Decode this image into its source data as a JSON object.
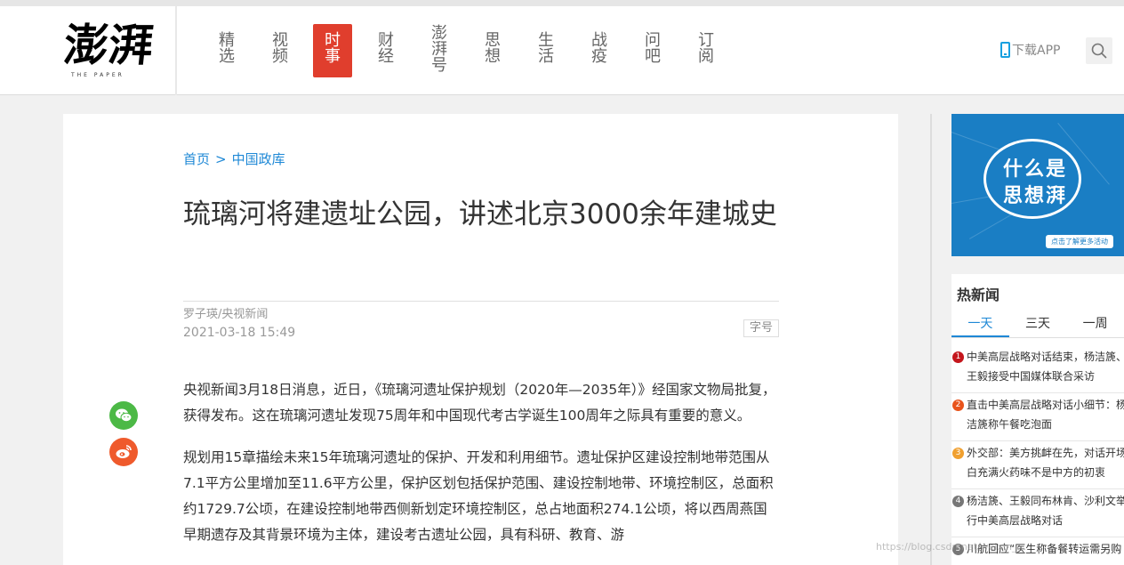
{
  "header": {
    "logo_cn": "澎湃",
    "logo_en": "THE PAPER",
    "nav": [
      {
        "line1": "精",
        "line2": "选",
        "line3": ""
      },
      {
        "line1": "视",
        "line2": "频",
        "line3": ""
      },
      {
        "line1": "时",
        "line2": "事",
        "line3": ""
      },
      {
        "line1": "财",
        "line2": "经",
        "line3": ""
      },
      {
        "line1": "澎",
        "line2": "湃",
        "line3": "号"
      },
      {
        "line1": "思",
        "line2": "想",
        "line3": ""
      },
      {
        "line1": "生",
        "line2": "活",
        "line3": ""
      },
      {
        "line1": "战",
        "line2": "疫",
        "line3": ""
      },
      {
        "line1": "问",
        "line2": "吧",
        "line3": ""
      },
      {
        "line1": "订",
        "line2": "阅",
        "line3": ""
      }
    ],
    "active_nav": "时事",
    "download": "下载APP"
  },
  "article": {
    "breadcrumb_home": "首页",
    "breadcrumb_sep": ">",
    "breadcrumb_section": "中国政库",
    "title": "琉璃河将建遗址公园，讲述北京3000余年建城史",
    "author": "罗子瑛/央视新闻",
    "date": "2021-03-18 15:49",
    "font_size_label": "字号",
    "paragraph1": "央视新闻3月18日消息，近日，《琉璃河遗址保护规划（2020年—2035年）》经国家文物局批复，获得发布。这在琉璃河遗址发现75周年和中国现代考古学诞生100周年之际具有重要的意义。",
    "paragraph2": "规划用15章描绘未来15年琉璃河遗址的保护、开发和利用细节。遗址保护区建设控制地带范围从7.1平方公里增加至11.6平方公里，保护区划包括保护范围、建设控制地带、环境控制区，总面积约1729.7公顷，在建设控制地带西侧新划定环境控制区，总占地面积274.1公顷，将以西周燕国早期遗存及其背景环境为主体，建设考古遗址公园，具有科研、教育、游"
  },
  "ad": {
    "line1": "什么是",
    "line2": "思想湃",
    "cta": "点击了解更多活动"
  },
  "hot": {
    "title": "热新闻",
    "tabs": [
      "一天",
      "三天",
      "一周"
    ],
    "items": [
      {
        "num": "1",
        "color": "#c4161c",
        "text": "中美高层战略对话结束，杨洁篪、王毅接受中国媒体联合采访"
      },
      {
        "num": "2",
        "color": "#e8541c",
        "text": "直击中美高层战略对话小细节：杨洁篪称午餐吃泡面"
      },
      {
        "num": "3",
        "color": "#f0a030",
        "text": "外交部：美方挑衅在先，对话开场白充满火药味不是中方的初衷"
      },
      {
        "num": "4",
        "color": "#777777",
        "text": "杨洁篪、王毅同布林肯、沙利文举行中美高层战略对话"
      },
      {
        "num": "5",
        "color": "#777777",
        "text": "川航回应“医生称备餐转运需另购"
      }
    ]
  },
  "watermark": "https://blog.csdn.net/weixin_..."
}
